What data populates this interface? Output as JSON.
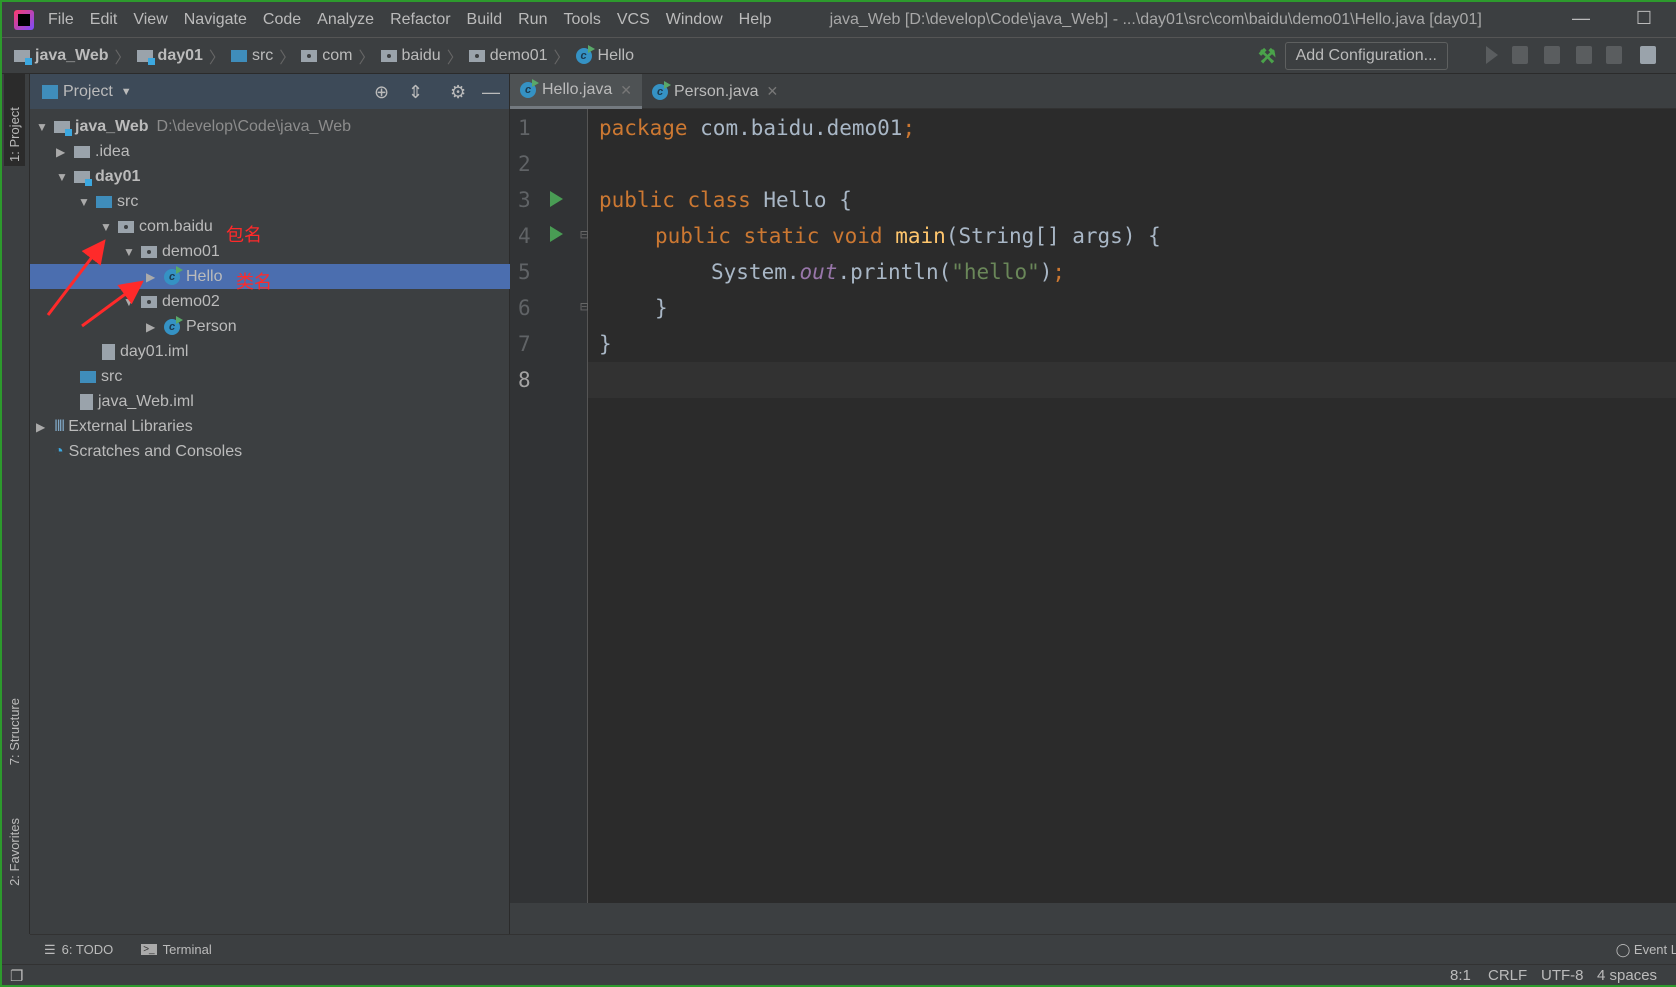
{
  "title_bar": {
    "menus": [
      "File",
      "Edit",
      "View",
      "Navigate",
      "Code",
      "Analyze",
      "Refactor",
      "Build",
      "Run",
      "Tools",
      "VCS",
      "Window",
      "Help"
    ],
    "window_title": "java_Web [D:\\develop\\Code\\java_Web] - ...\\day01\\src\\com\\baidu\\demo01\\Hello.java [day01]"
  },
  "nav_bar": {
    "breadcrumbs": [
      "java_Web",
      "day01",
      "src",
      "com",
      "baidu",
      "demo01",
      "Hello"
    ],
    "add_configuration": "Add Configuration..."
  },
  "left_strip": {
    "project": "1: Project",
    "structure": "7: Structure",
    "favorites": "2: Favorites"
  },
  "project_panel": {
    "title": "Project",
    "tree": [
      {
        "label": "java_Web",
        "hint": "D:\\develop\\Code\\java_Web"
      },
      {
        "label": ".idea"
      },
      {
        "label": "day01"
      },
      {
        "label": "src"
      },
      {
        "label": "com.baidu"
      },
      {
        "label": "demo01"
      },
      {
        "label": "Hello"
      },
      {
        "label": "demo02"
      },
      {
        "label": "Person"
      },
      {
        "label": "day01.iml"
      },
      {
        "label": "src"
      },
      {
        "label": "java_Web.iml"
      },
      {
        "label": "External Libraries"
      },
      {
        "label": "Scratches and Consoles"
      }
    ],
    "selected": "Hello"
  },
  "annotations": {
    "package_name": "包名",
    "class_name": "类名",
    "color": "#ff2a2a"
  },
  "tabs": [
    {
      "label": "Hello.java",
      "active": true
    },
    {
      "label": "Person.java",
      "active": false
    }
  ],
  "editor": {
    "line_numbers": [
      "1",
      "2",
      "3",
      "4",
      "5",
      "6",
      "7",
      "8"
    ],
    "current_line": 8,
    "code": {
      "l1_kw": "package",
      "l1_rest": " com.baidu.demo01",
      "l1_semi": ";",
      "l3_kw": "public class",
      "l3_rest": " Hello {",
      "l4_kw": "public static void",
      "l4_fn": "main",
      "l4_rest": "(String[] args) {",
      "l5_a": "System.",
      "l5_field": "out",
      "l5_b": ".println(",
      "l5_str": "\"hello\"",
      "l5_c": ")",
      "l5_semi": ";",
      "l6": "}",
      "l7": "}"
    }
  },
  "bottom_bar": {
    "todo": "6: TODO",
    "terminal": "Terminal",
    "event_log": "Event L"
  },
  "status_bar": {
    "position": "8:1",
    "line_ending": "CRLF",
    "encoding": "UTF-8",
    "indent": "4 spaces"
  },
  "colors": {
    "keyword": "#cc7832",
    "string": "#6a8759",
    "method": "#ffc66d",
    "field": "#9876aa",
    "selection": "#4b6eaf"
  }
}
